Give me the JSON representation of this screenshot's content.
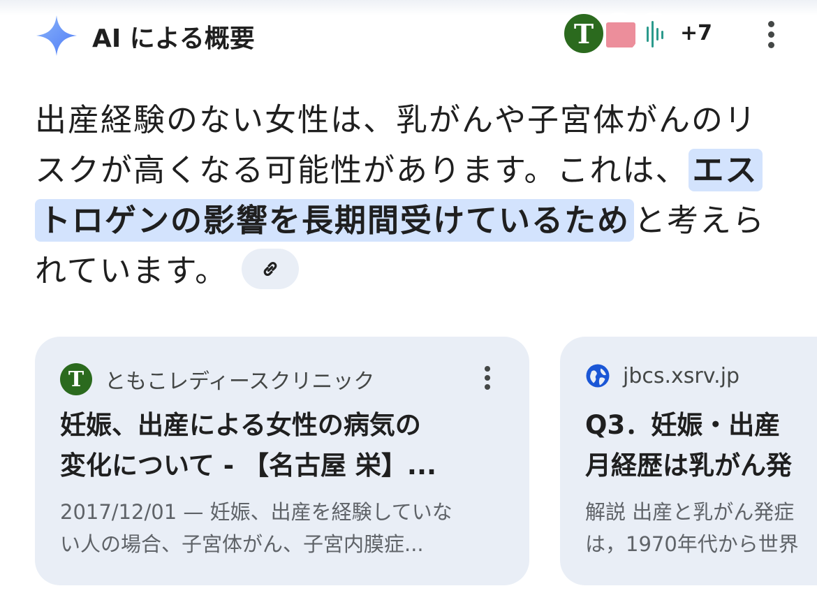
{
  "header": {
    "title": "AI による概要",
    "avatar_letter": "T",
    "more_count": "+7",
    "icons": [
      "sparkle-icon",
      "avatar-icon",
      "more-vert-icon"
    ]
  },
  "answer": {
    "text_before": "出産経験のない女性は、乳がんや子宮体がんのリスクが高くなる可能性があります。これは、",
    "highlight": "エストロゲンの影響を長期間受けているため",
    "text_after": "と考えられています。",
    "link_icon": "link-icon"
  },
  "cards": [
    {
      "favicon_letter": "T",
      "source": "ともこレディースクリニック",
      "title_lines": [
        "妊娠、出産による女性の病気の",
        "変化について - 【名古屋 栄】..."
      ],
      "snippet_lines": [
        "2017/12/01 — 妊娠、出産を経験していな",
        "い人の場合、子宮体がん、子宮内膜症..."
      ]
    },
    {
      "favicon_icon": "globe-icon",
      "source": "jbcs.xsrv.jp",
      "title_lines": [
        "Q3．妊娠・出産",
        "月経歴は乳がん発"
      ],
      "snippet_lines": [
        "解説 出産と乳がん発症",
        "は，1970年代から世界"
      ]
    }
  ],
  "colors": {
    "highlight": "#d3e3fd",
    "card_bg": "#e9eef6",
    "favicon_green": "#2b6a1e",
    "globe_blue": "#1a56d6"
  }
}
